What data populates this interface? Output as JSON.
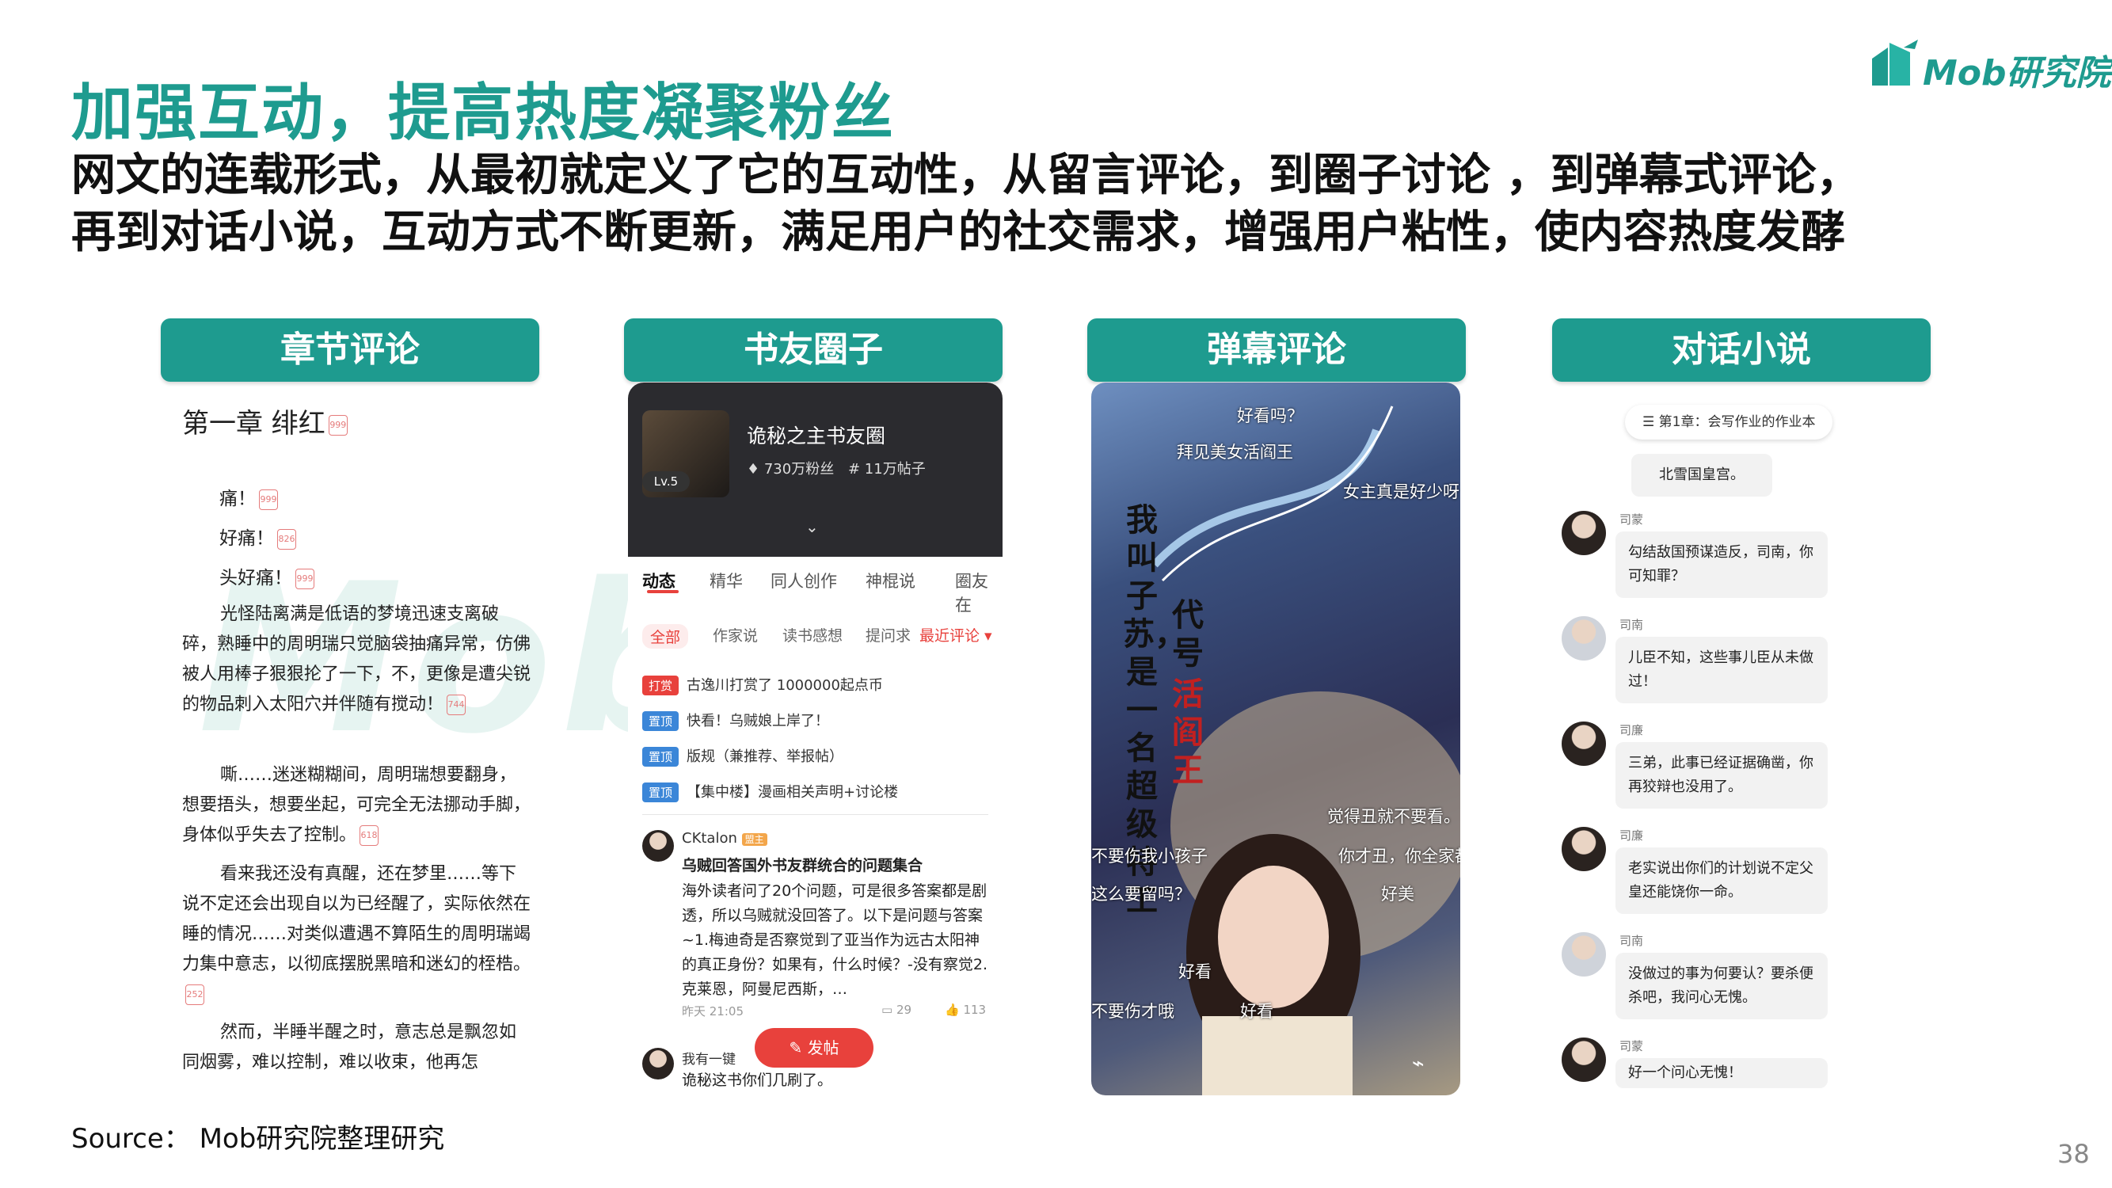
{
  "header": {
    "title": "加强互动，提高热度凝聚粉丝",
    "subtitle_line1": "网文的连载形式，从最初就定义了它的互动性，从留言评论，到圈子讨论 ，到弹幕式评论，",
    "subtitle_line2": "再到对话小说，互动方式不断更新，满足用户的社交需求，增强用户粘性，使内容热度发酵",
    "logo_text": "Mob研究院"
  },
  "watermark": "Mob研",
  "cards": [
    "章节评论",
    "书友圈子",
    "弹幕评论",
    "对话小说"
  ],
  "chapter_panel": {
    "chapter_title": "第一章 绯红",
    "chapter_badge": "999",
    "short_lines": [
      {
        "text": "痛！",
        "badge": "999"
      },
      {
        "text": "好痛！",
        "badge": "826"
      },
      {
        "text": "头好痛！",
        "badge": "999"
      }
    ],
    "paragraphs": [
      {
        "text": "光怪陆离满是低语的梦境迅速支离破碎，熟睡中的周明瑞只觉脑袋抽痛异常，仿佛被人用棒子狠狠抡了一下，不，更像是遭尖锐的物品刺入太阳穴并伴随有搅动！",
        "badge": "744"
      },
      {
        "text": "嘶……迷迷糊糊间，周明瑞想要翻身，想要捂头，想要坐起，可完全无法挪动手脚，身体似乎失去了控制。",
        "badge": "618"
      },
      {
        "text": "看来我还没有真醒，还在梦里……等下说不定还会出现自以为已经醒了，实际依然在睡的情况……对类似遭遇不算陌生的周明瑞竭力集中意志，以彻底摆脱黑暗和迷幻的桎梏。",
        "badge": "252"
      },
      {
        "text": "然而，半睡半醒之时，意志总是飘忽如同烟雾，难以控制，难以收束，他再怎",
        "badge": ""
      }
    ]
  },
  "circle_panel": {
    "circle_name": "诡秘之主书友圈",
    "level": "Lv.5",
    "fans": "730万粉丝",
    "posts_count": "# 11万帖子",
    "tabs": [
      "动态",
      "精华",
      "同人创作",
      "神棍说",
      "圈友在"
    ],
    "chips": [
      "全部",
      "作家说",
      "读书感想",
      "提问求",
      "最近评论 ▾"
    ],
    "pinned": [
      {
        "tag": "打赏",
        "text": "古逸川打赏了 1000000起点币",
        "color": "#e8413c"
      },
      {
        "tag": "置顶",
        "text": "快看！乌贼娘上岸了！",
        "color": "#3b86d8"
      },
      {
        "tag": "置顶",
        "text": "版规（兼推荐、举报帖）",
        "color": "#3b86d8"
      },
      {
        "tag": "置顶",
        "text": "【集中楼】漫画相关声明+讨论楼",
        "color": "#3b86d8"
      }
    ],
    "post": {
      "author": "CKtalon",
      "author_tag": "盟主",
      "title": "乌贼回答国外书友群统合的问题集合",
      "body": "海外读者问了20个问题，可是很多答案都是剧透，所以乌贼就没回答了。以下是问题与答案~1.梅迪奇是否察觉到了亚当作为远古太阳神的真正身份？如果有，什么时候？-没有察觉2.克莱恩，阿曼尼西斯，…",
      "time": "昨天 21:05",
      "comments": "29",
      "likes": "113"
    },
    "post2_author": "我有一键",
    "post2_body": "诡秘这书你们几刷了。",
    "fab_label": "发帖"
  },
  "danmaku_panel": {
    "comments": [
      "好看吗？",
      "拜见美女活阎王",
      "女主真是好少呀",
      "觉得丑就不要看。",
      "不要伤我小孩子",
      "你才丑，你全家都",
      "这么要留吗？",
      "好美",
      "好看",
      "不要伤才哦",
      "好看"
    ],
    "vertical_text_left": "我叫子苏，是一名超级特工",
    "vertical_text_right_black": "代号",
    "vertical_text_right_red": "活阎王"
  },
  "chat_panel": {
    "chapter_pill": "第1章：会写作业的作业本",
    "narration": "北雪国皇宫。",
    "messages": [
      {
        "speaker": "司蒙",
        "text": "勾结敌国预谋造反，司南，你可知罪？"
      },
      {
        "speaker": "司南",
        "text": "儿臣不知，这些事儿臣从未做过！"
      },
      {
        "speaker": "司廉",
        "text": "三弟，此事已经证据确凿，你再狡辩也没用了。"
      },
      {
        "speaker": "司廉",
        "text": "老实说出你们的计划说不定父皇还能饶你一命。"
      },
      {
        "speaker": "司南",
        "text": "没做过的事为何要认？要杀便杀吧，我问心无愧。"
      },
      {
        "speaker": "司蒙",
        "text": "好一个问心无愧！"
      }
    ]
  },
  "footer": {
    "source": "Source： Mob研究院整理研究",
    "page_number": "38"
  },
  "colors": {
    "accent": "#1e9b8f",
    "red": "#e8413c",
    "blue": "#3b86d8"
  }
}
